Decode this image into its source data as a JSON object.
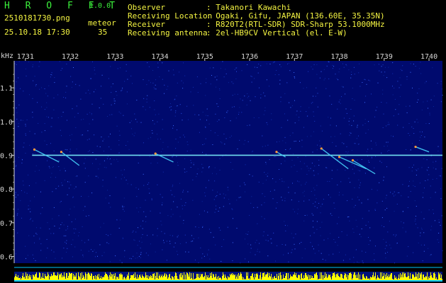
{
  "app": {
    "name": "H R O F F T",
    "version": "1.0.0"
  },
  "file": {
    "name": "2510181730.png",
    "datetime": "25.10.18 17:30"
  },
  "meteor": {
    "label": "meteor",
    "count": "35"
  },
  "station": [
    {
      "key": "Observer",
      "value": ": Takanori Kawachi"
    },
    {
      "key": "Receiving Location",
      "value": ": Ogaki, Gifu, JAPAN (136.60E, 35.35N)"
    },
    {
      "key": "Receiver",
      "value": ": R820T2(RTL-SDR) SDR-Sharp 53.1000MHz"
    },
    {
      "key": "Receiving antenna",
      "value": ": 2el-HB9CV Vertical (el. E-W)"
    }
  ],
  "chart_data": {
    "type": "heatmap",
    "ylabel": "kHz",
    "x_ticks": [
      "1731",
      "1732",
      "1733",
      "1734",
      "1735",
      "1736",
      "1737",
      "1738",
      "1739",
      "1740"
    ],
    "y_ticks": [
      "1.1",
      "1.0",
      "0.9",
      "0.8",
      "0.7",
      "0.6"
    ],
    "x_range": [
      1730.75,
      1740.3
    ],
    "y_range": [
      0.58,
      1.18
    ],
    "carrier_khz": 0.9,
    "meteor_echoes": [
      {
        "start": 1731.2,
        "end": 1731.75,
        "f_start": 0.917,
        "f_end": 0.88
      },
      {
        "start": 1731.8,
        "end": 1732.2,
        "f_start": 0.91,
        "f_end": 0.87
      },
      {
        "start": 1733.9,
        "end": 1734.3,
        "f_start": 0.905,
        "f_end": 0.88
      },
      {
        "start": 1736.6,
        "end": 1736.8,
        "f_start": 0.91,
        "f_end": 0.895
      },
      {
        "start": 1737.6,
        "end": 1738.2,
        "f_start": 0.92,
        "f_end": 0.86
      },
      {
        "start": 1738.0,
        "end": 1738.6,
        "f_start": 0.895,
        "f_end": 0.86
      },
      {
        "start": 1738.3,
        "end": 1738.8,
        "f_start": 0.885,
        "f_end": 0.845
      },
      {
        "start": 1739.7,
        "end": 1740.0,
        "f_start": 0.925,
        "f_end": 0.91
      }
    ],
    "colors": {
      "background": "#000a6e",
      "carrier": "#7df5ff",
      "echo": "#49d8ff",
      "axis": "#d8d8d8",
      "noise_bar": "#ffff00",
      "baseline": "#00c8ff"
    }
  }
}
